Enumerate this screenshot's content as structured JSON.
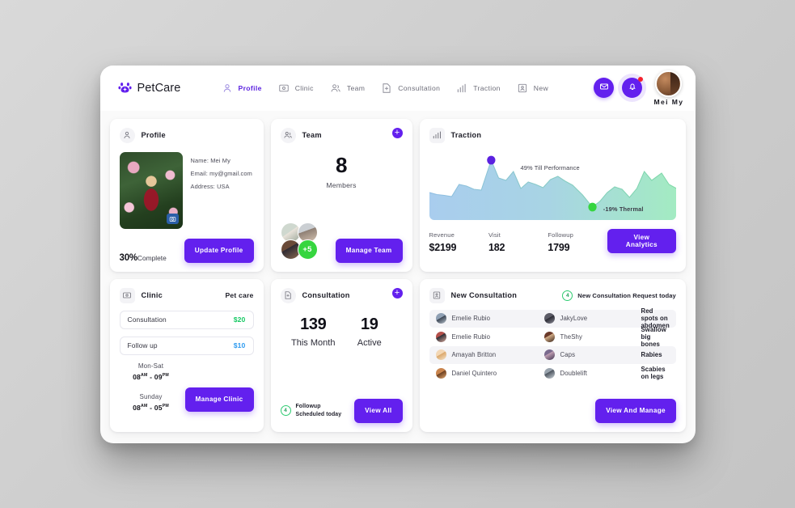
{
  "brand": {
    "name": "PetCare",
    "icon": "paw-icon",
    "color": "#6320ee"
  },
  "nav": {
    "items": [
      {
        "label": "Profile",
        "icon": "user-icon",
        "active": true
      },
      {
        "label": "Clinic",
        "icon": "clinic-icon",
        "active": false
      },
      {
        "label": "Team",
        "icon": "users-icon",
        "active": false
      },
      {
        "label": "Consultation",
        "icon": "plus-circle-icon",
        "active": false
      },
      {
        "label": "Traction",
        "icon": "bar-chart-icon",
        "active": false
      },
      {
        "label": "New",
        "icon": "ticket-icon",
        "active": false
      }
    ]
  },
  "header_right": {
    "mail_icon": "envelope-icon",
    "bell_icon": "bell-icon",
    "username": "Mei My"
  },
  "profile_card": {
    "title": "Profile",
    "icon": "user-icon",
    "photo_badge_icon": "camera-icon",
    "info": [
      "Name: Mei My",
      "Email: my@gmail.com",
      "Address: USA"
    ],
    "percent": "30%",
    "percent_suffix": "Complete",
    "button": "Update Profile"
  },
  "team_card": {
    "title": "Team",
    "icon": "users-icon",
    "add_icon": "plus-icon",
    "count": "8",
    "count_label": "Members",
    "extra_members": "+5",
    "button": "Manage Team"
  },
  "traction_card": {
    "title": "Traction",
    "icon": "bar-chart-icon",
    "note_top": "49% Till Performance",
    "note_bottom": "-19% Thermal",
    "stats": [
      {
        "label": "Revenue",
        "value": "$2199"
      },
      {
        "label": "Visit",
        "value": "182"
      },
      {
        "label": "Followup",
        "value": "1799"
      }
    ],
    "button": "View Analytics"
  },
  "chart_data": {
    "type": "area",
    "title": "Traction",
    "xlabel": "",
    "ylabel": "",
    "grid": false,
    "legend": "none",
    "ylim": [
      0,
      100
    ],
    "annotations": [
      {
        "label": "49% Till Performance",
        "x": 25,
        "y": 86,
        "marker_color": "#5b21e0"
      },
      {
        "label": "-19% Thermal",
        "x": 66,
        "y": 18,
        "marker_color": "#36d53f"
      }
    ],
    "series": [
      {
        "name": "Traction",
        "x": [
          0,
          3,
          6,
          9,
          12,
          15,
          18,
          21,
          25,
          28,
          31,
          34,
          37,
          40,
          43,
          46,
          49,
          52,
          55,
          58,
          62,
          66,
          69,
          72,
          75,
          78,
          81,
          84,
          87,
          90,
          94,
          97,
          100
        ],
        "values": [
          40,
          37,
          36,
          34,
          52,
          50,
          45,
          44,
          86,
          60,
          57,
          70,
          46,
          55,
          52,
          47,
          58,
          62,
          55,
          50,
          36,
          18,
          26,
          40,
          48,
          44,
          33,
          46,
          70,
          56,
          66,
          50,
          44
        ]
      }
    ],
    "gradient_start": "#a9cdee",
    "gradient_end": "#a9ecc4"
  },
  "clinic_card": {
    "title": "Clinic",
    "icon": "clinic-icon",
    "subtitle": "Pet care",
    "services": [
      {
        "name": "Consultation",
        "price": "$20",
        "price_color": "#17c964"
      },
      {
        "name": "Follow up",
        "price": "$10",
        "price_color": "#2f9bf0"
      }
    ],
    "hours": [
      {
        "day": "Mon-Sat",
        "open": "08",
        "open_suffix": "AM",
        "close": "09",
        "close_suffix": "PM"
      },
      {
        "day": "Sunday",
        "open": "08",
        "open_suffix": "AM",
        "close": "05",
        "close_suffix": "PM"
      }
    ],
    "button": "Manage Clinic"
  },
  "consultation_card": {
    "title": "Consultation",
    "icon": "plus-circle-icon",
    "add_icon": "plus-icon",
    "month_count": "139",
    "month_label": "This Month",
    "active_count": "19",
    "active_label": "Active",
    "badge_count": "4",
    "badge_line1": "Followup",
    "badge_line2": "Scheduled today",
    "button": "View All"
  },
  "new_consultation_card": {
    "title": "New Consultation",
    "icon": "ticket-icon",
    "badge_count": "4",
    "badge_text": "New Consultation Request today",
    "rows": [
      {
        "owner": "Emelie Rubio",
        "pet": "JakyLove",
        "issue": "Red spots on abdomen"
      },
      {
        "owner": "Emelie Rubio",
        "pet": "TheShy",
        "issue": "Swallow big bones"
      },
      {
        "owner": "Amayah Britton",
        "pet": "Caps",
        "issue": "Rabies"
      },
      {
        "owner": "Daniel Quintero",
        "pet": "Doublelift",
        "issue": "Scabies on legs"
      }
    ],
    "button": "View And Manage"
  }
}
